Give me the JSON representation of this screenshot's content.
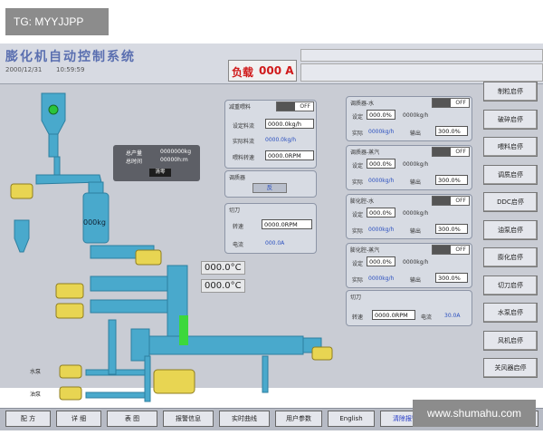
{
  "app": {
    "title": "膨化机自动控制系统",
    "date": "2000/12/31",
    "time": "10:59:59"
  },
  "load": {
    "label": "负载",
    "value": "000 A"
  },
  "stats": {
    "output_label": "总产量",
    "output_value": "0000000kg",
    "hours_label": "总时间",
    "hours_value": "00000h:m",
    "reset_label": "清零"
  },
  "feed_panel": {
    "title": "减重喂料",
    "switch": "OFF",
    "set_label": "设定料流",
    "set_value": "0000.0kg/h",
    "actual_label": "实际料流",
    "actual_value": "0000.0kg/h",
    "speed_label": "喂料转速",
    "speed_value": "0000.0RPM"
  },
  "conditioner": {
    "title": "调质器",
    "value": "反"
  },
  "cutter1": {
    "title": "切刀",
    "speed_label": "转速",
    "speed_value": "0000.0RPM",
    "current_label": "电流",
    "current_value": "000.0A"
  },
  "bin_weight": "000kg",
  "temps": [
    "000.0°C",
    "000.0°C"
  ],
  "right_panels": [
    {
      "title": "调质器-水",
      "switch": "OFF",
      "set_label": "设定",
      "set_value": "000.0%",
      "set_flow": "0000kg/h",
      "actual_label": "实际",
      "actual_value": "0000kg/h",
      "out_label": "输出",
      "out_value": "300.0%"
    },
    {
      "title": "调质器-蒸汽",
      "switch": "OFF",
      "set_label": "设定",
      "set_value": "000.0%",
      "set_flow": "0000kg/h",
      "actual_label": "实际",
      "actual_value": "0000kg/h",
      "out_label": "输出",
      "out_value": "300.0%"
    },
    {
      "title": "膨化腔-水",
      "switch": "OFF",
      "set_label": "设定",
      "set_value": "000.0%",
      "set_flow": "0000kg/h",
      "actual_label": "实际",
      "actual_value": "0000kg/h",
      "out_label": "输出",
      "out_value": "300.0%"
    },
    {
      "title": "膨化腔-蒸汽",
      "switch": "OFF",
      "set_label": "设定",
      "set_value": "000.0%",
      "set_flow": "0000kg/h",
      "actual_label": "实际",
      "actual_value": "0000kg/h",
      "out_label": "输出",
      "out_value": "300.0%"
    }
  ],
  "cutter2": {
    "title": "切刀",
    "speed_label": "转速",
    "speed_value": "0000.0RPM",
    "current_label": "电流",
    "current_value": "30.0A"
  },
  "machine_labels": {
    "water_pump": "水泵",
    "oil_pump": "油泵"
  },
  "side_buttons": [
    "制粒启停",
    "破碎启停",
    "喂料启停",
    "调质启停",
    "DDC启停",
    "油泵启停",
    "膨化启停",
    "切刀启停",
    "水泵启停",
    "风机启停",
    "关风器启停"
  ],
  "bottom_buttons": [
    "配 方",
    "详 细",
    "表 图",
    "报警信息",
    "实时曲线",
    "用户参数",
    "English",
    "清除报警",
    "全部自动",
    "自动启停"
  ],
  "watermarks": {
    "tag": "TG: MYYJJPP",
    "site": "www.shumahu.com"
  }
}
